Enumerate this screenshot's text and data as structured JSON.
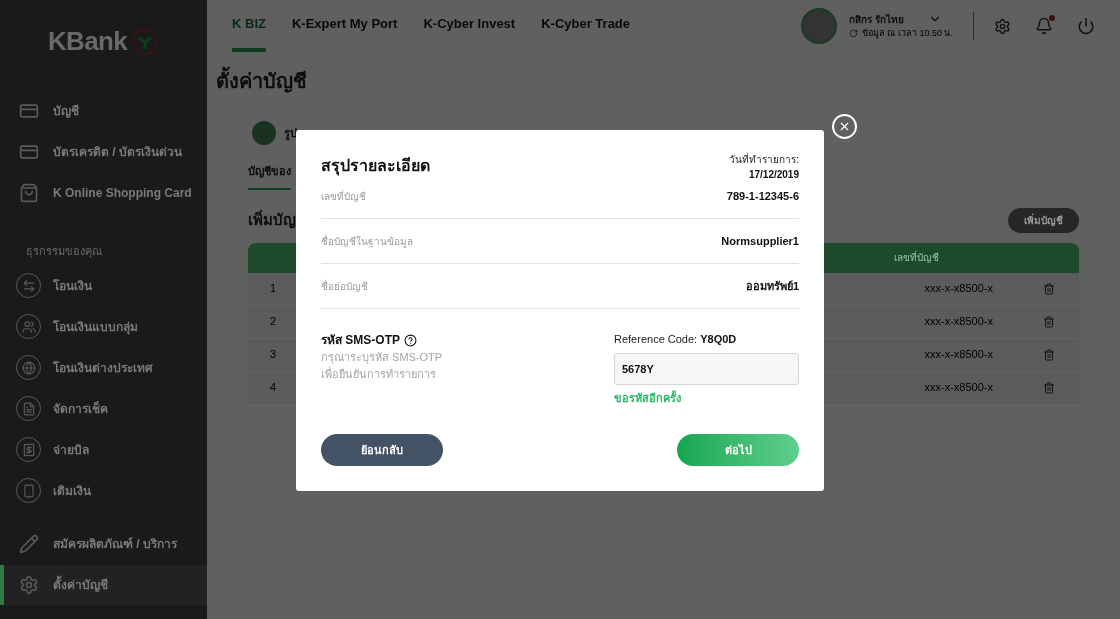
{
  "sidebar": {
    "logo": "KBank",
    "items": [
      {
        "label": "บัญชี",
        "selected": false
      },
      {
        "label": "บัตรเครดิต / บัตรเงินด่วน",
        "selected": false
      },
      {
        "label": "K Online Shopping Card",
        "selected": false
      }
    ],
    "section_title": "ธุรกรรมของคุณ",
    "transactions": [
      {
        "label": "โอนเงิน",
        "selected": false
      },
      {
        "label": "โอนเงินแบบกลุ่ม",
        "selected": false
      },
      {
        "label": "โอนเงินต่างประเทศ",
        "selected": false
      },
      {
        "label": "จัดการเช็ค",
        "selected": false
      },
      {
        "label": "จ่ายบิล",
        "selected": false
      },
      {
        "label": "เติมเงิน",
        "selected": false
      }
    ],
    "footer": [
      {
        "label": "สมัครผลิตภัณฑ์ / บริการ",
        "selected": false
      },
      {
        "label": "ตั้งค่าบัญชี",
        "selected": true
      }
    ]
  },
  "header": {
    "tabs": [
      {
        "label": "K BIZ",
        "selected": true
      },
      {
        "label": "K-Expert My Port",
        "selected": false
      },
      {
        "label": "K-Cyber Invest",
        "selected": false
      },
      {
        "label": "K-Cyber Trade",
        "selected": false
      }
    ],
    "user": {
      "name": "กสิกร รักไทย",
      "updated": "ข้อมูล ณ เวลา 10.50 น."
    },
    "notification": true
  },
  "page": {
    "title": "ตั้งค่าบัญชี",
    "step_label": "รูป",
    "tab_label": "บัญชีของ",
    "section_title": "เพิ่มบัญ",
    "add_button": "เพิ่มบัญชี",
    "table": {
      "column_header": "เลขที่บัญชี",
      "rows": [
        {
          "index": "1",
          "account": "xxx-x-x8500-x"
        },
        {
          "index": "2",
          "account": "xxx-x-x8500-x"
        },
        {
          "index": "3",
          "account": "xxx-x-x8500-x"
        },
        {
          "index": "4",
          "account": "xxx-x-x8500-x"
        }
      ]
    }
  },
  "dialog": {
    "title": "สรุปรายละเอียด",
    "date_label": "วันที่ทำรายการ:",
    "date": "17/12/2019",
    "fields": [
      {
        "label": "เลขที่บัญชี",
        "value": "789-1-12345-6"
      },
      {
        "label": "ชื่อบัญชีในฐานข้อมูล",
        "value": "Normsupplier1"
      },
      {
        "label": "ชื่อย่อบัญชี",
        "value": "ออมทรัพย์1"
      }
    ],
    "otp": {
      "title": "รหัส SMS-OTP",
      "hint": "กรุณาระบุรหัส SMS-OTP เพื่อยืนยันการทำรายการ",
      "reference_label": "Reference Code:",
      "reference_code": "Y8Q0D",
      "value": "5678Y",
      "resend": "ขอรหัสอีกครั้ง"
    },
    "back_button": "ย้อนกลับ",
    "next_button": "ต่อไป"
  }
}
